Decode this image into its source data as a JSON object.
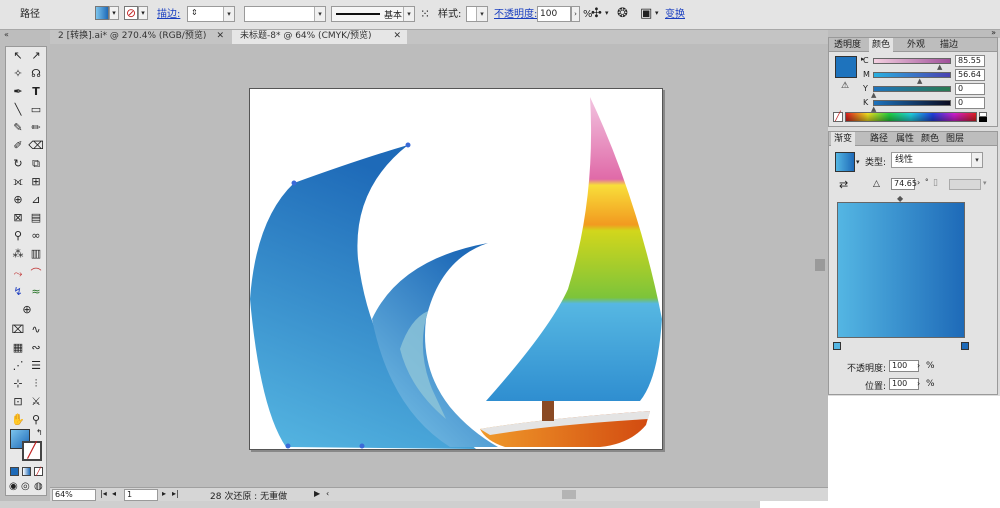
{
  "control_bar": {
    "object_type": "路径",
    "stroke_label": "描边:",
    "stroke_profile": "基本",
    "style_label": "样式:",
    "opacity_label": "不透明度:",
    "opacity_value": "100",
    "opacity_unit": "%",
    "transform_label": "变换"
  },
  "doc_tabs": [
    {
      "title": "2 [转换].ai* @ 270.4% (RGB/预览)"
    },
    {
      "title": "未标题-8* @ 64% (CMYK/预览)"
    }
  ],
  "status_bar": {
    "zoom": "64%",
    "artboard": "1",
    "history": "28 次还原 : 无重做"
  },
  "color_panel": {
    "tabs": [
      "透明度",
      "颜色",
      "外观",
      "描边"
    ],
    "channels": [
      {
        "name": "C",
        "value": "85.55"
      },
      {
        "name": "M",
        "value": "56.64"
      },
      {
        "name": "Y",
        "value": "0"
      },
      {
        "name": "K",
        "value": "0"
      }
    ],
    "fill_color": "#1e73bd"
  },
  "gradient_panel": {
    "tabs": [
      "渐变",
      "路径",
      "属性",
      "颜色",
      "图层"
    ],
    "type_label": "类型:",
    "type_value": "线性",
    "angle": "74.65",
    "opacity_label": "不透明度:",
    "opacity_value": "100",
    "location_label": "位置:",
    "location_value": "100",
    "percent": "%",
    "start_color": "#54b6e3",
    "end_color": "#1e6ab8"
  }
}
